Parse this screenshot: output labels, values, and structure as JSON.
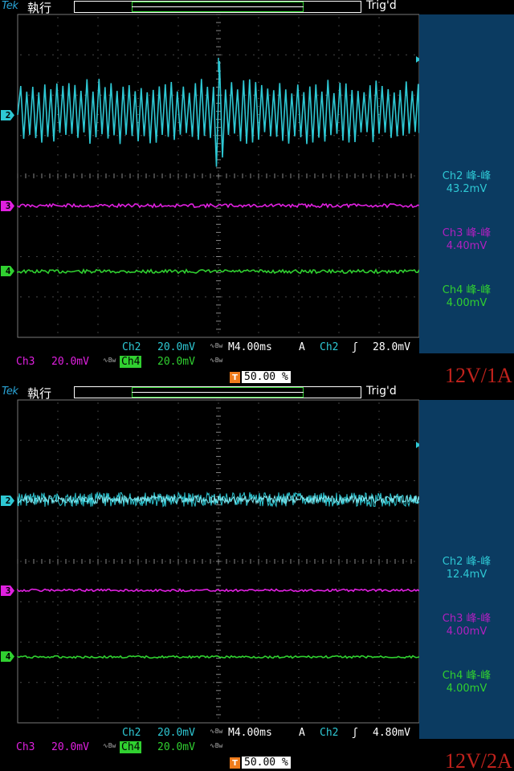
{
  "panels": [
    {
      "brand": "Tek",
      "run_state": "執行",
      "trigger_status": "Trig'd",
      "channels": [
        {
          "id": "2",
          "color": "#2ec8d4",
          "name": "Ch2"
        },
        {
          "id": "3",
          "color": "#e020e0",
          "name": "Ch3"
        },
        {
          "id": "4",
          "color": "#30d030",
          "name": "Ch4"
        }
      ],
      "measurements": [
        {
          "label": "Ch2 峰-峰",
          "value": "43.2mV",
          "color": "#2ec8d4"
        },
        {
          "label": "Ch3 峰-峰",
          "value": "4.40mV",
          "color": "#b020c0"
        },
        {
          "label": "Ch4 峰-峰",
          "value": "4.00mV",
          "color": "#30d030"
        }
      ],
      "status": {
        "ch2_label": "Ch2",
        "ch2_scale": "20.0mV",
        "timebase": "M4.00ms",
        "acq_mode": "A",
        "trig_source": "Ch2",
        "trig_level": "28.0mV",
        "ch3_label": "Ch3",
        "ch3_scale": "20.0mV",
        "ch4_label": "Ch4",
        "ch4_scale": "20.0mV",
        "trigger_position": "50.00 %"
      },
      "annotation": "12V/1A"
    },
    {
      "brand": "Tek",
      "run_state": "執行",
      "trigger_status": "Trig'd",
      "channels": [
        {
          "id": "2",
          "color": "#2ec8d4",
          "name": "Ch2"
        },
        {
          "id": "3",
          "color": "#e020e0",
          "name": "Ch3"
        },
        {
          "id": "4",
          "color": "#30d030",
          "name": "Ch4"
        }
      ],
      "measurements": [
        {
          "label": "Ch2 峰-峰",
          "value": "12.4mV",
          "color": "#2ec8d4"
        },
        {
          "label": "Ch3 峰-峰",
          "value": "4.00mV",
          "color": "#b020c0"
        },
        {
          "label": "Ch4 峰-峰",
          "value": "4.00mV",
          "color": "#30d030"
        }
      ],
      "status": {
        "ch2_label": "Ch2",
        "ch2_scale": "20.0mV",
        "timebase": "M4.00ms",
        "acq_mode": "A",
        "trig_source": "Ch2",
        "trig_level": "4.80mV",
        "ch3_label": "Ch3",
        "ch3_scale": "20.0mV",
        "ch4_label": "Ch4",
        "ch4_scale": "20.0mV",
        "trigger_position": "50.00 %"
      },
      "annotation": "12V/2A"
    }
  ]
}
